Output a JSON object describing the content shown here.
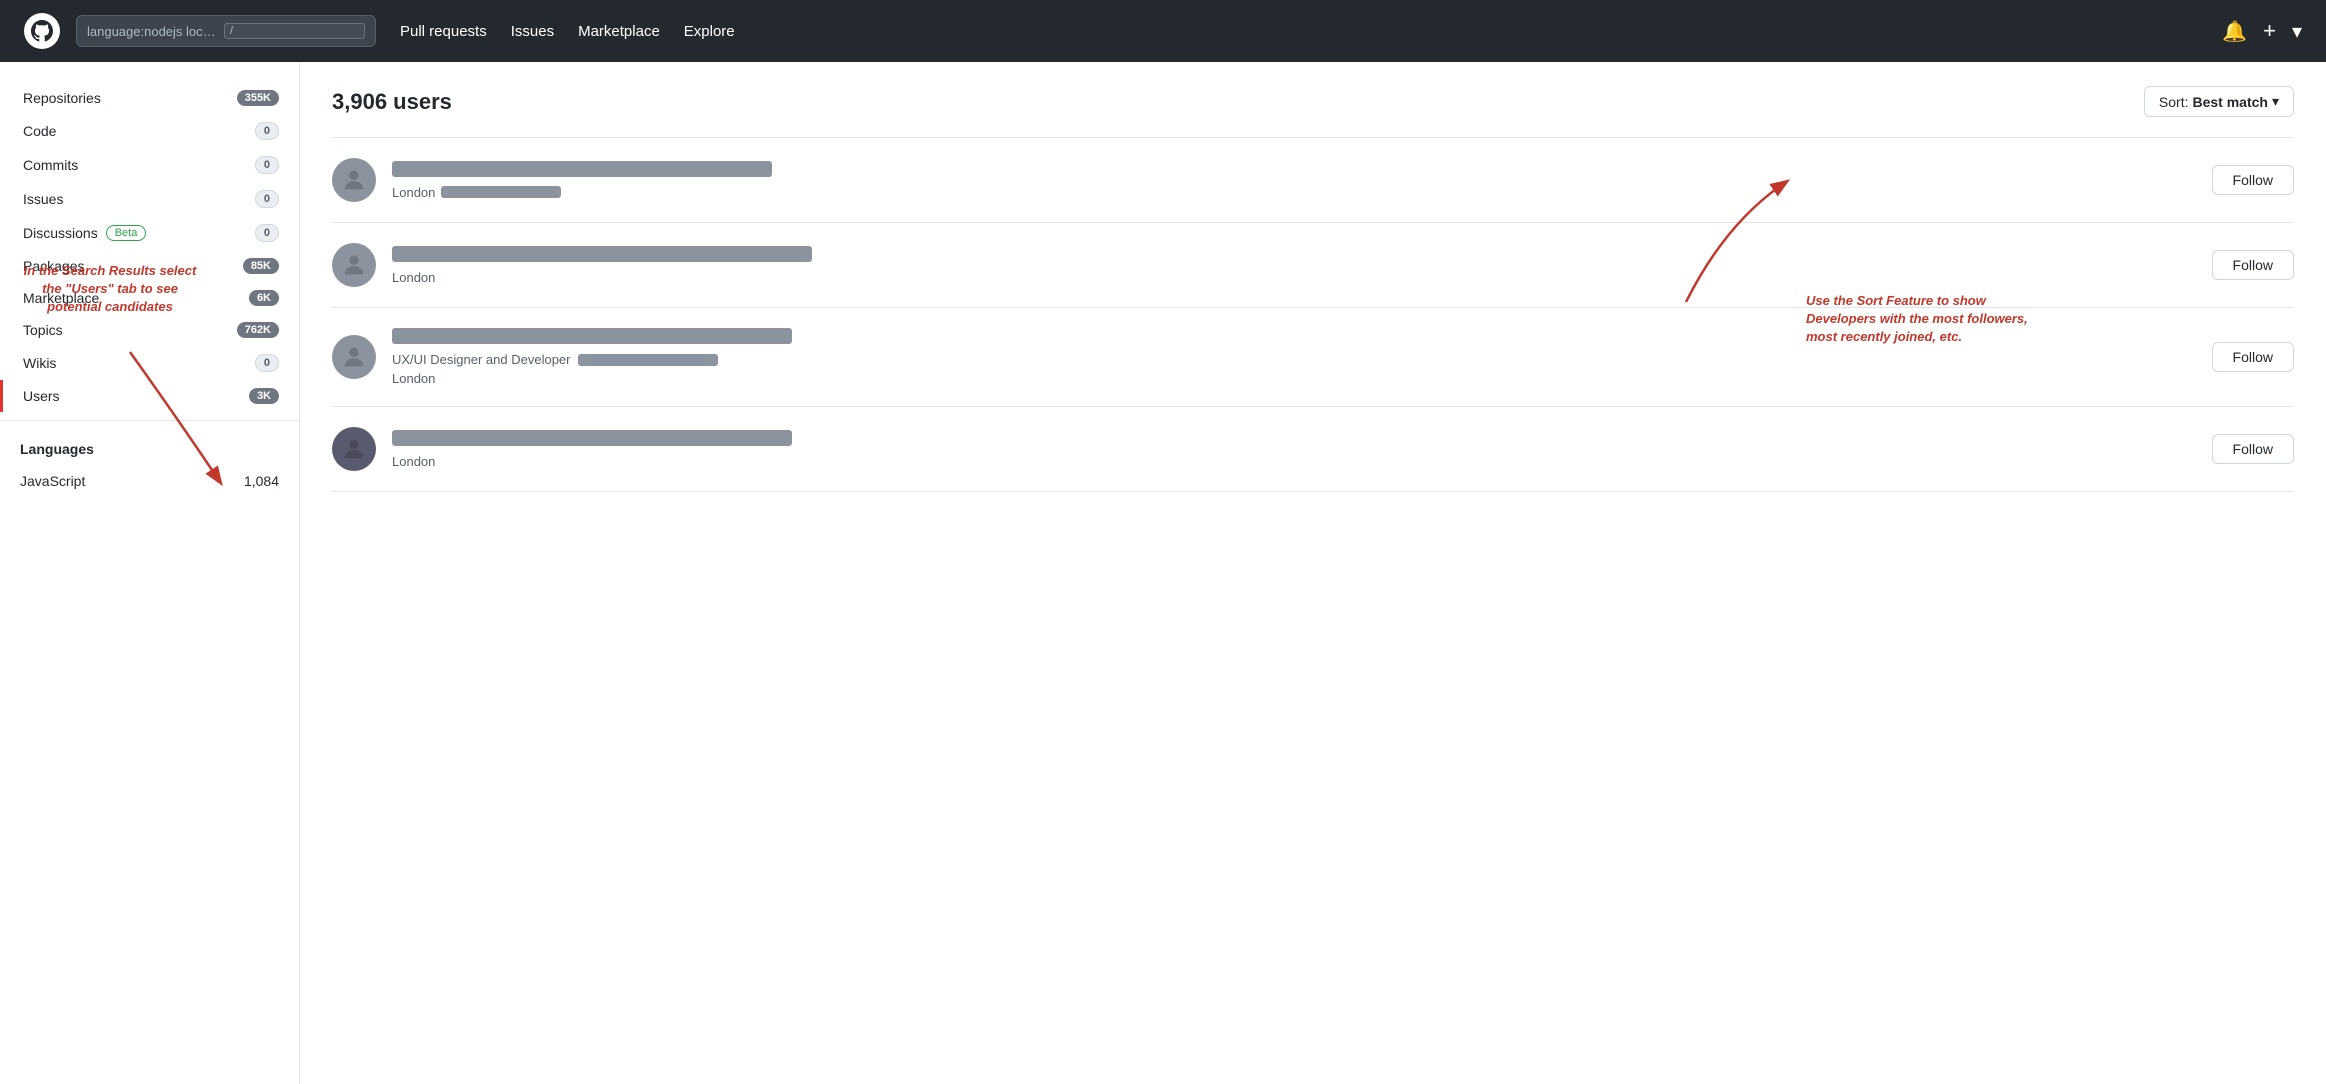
{
  "header": {
    "search_value": "language:nodejs location:london f",
    "kbd_label": "/",
    "nav_items": [
      {
        "label": "Pull requests",
        "href": "#"
      },
      {
        "label": "Issues",
        "href": "#"
      },
      {
        "label": "Marketplace",
        "href": "#"
      },
      {
        "label": "Explore",
        "href": "#"
      }
    ]
  },
  "sidebar": {
    "items": [
      {
        "label": "Repositories",
        "badge": "355K",
        "badge_type": "dark",
        "active": false
      },
      {
        "label": "Code",
        "badge": "0",
        "badge_type": "light",
        "active": false
      },
      {
        "label": "Commits",
        "badge": "0",
        "badge_type": "light",
        "active": false
      },
      {
        "label": "Issues",
        "badge": "0",
        "badge_type": "light",
        "active": false
      },
      {
        "label": "Discussions",
        "badge": "0",
        "badge_type": "light",
        "has_beta": true,
        "active": false
      },
      {
        "label": "Packages",
        "badge": "85K",
        "badge_type": "dark",
        "active": false
      },
      {
        "label": "Marketplace",
        "badge": "6K",
        "badge_type": "dark",
        "active": false
      },
      {
        "label": "Topics",
        "badge": "762K",
        "badge_type": "dark",
        "active": false
      },
      {
        "label": "Wikis",
        "badge": "0",
        "badge_type": "light",
        "active": false
      },
      {
        "label": "Users",
        "badge": "3K",
        "badge_type": "dark",
        "active": true
      }
    ],
    "languages_title": "Languages",
    "languages": [
      {
        "name": "JavaScript",
        "count": "1,084"
      }
    ]
  },
  "content": {
    "results_count": "3,906 users",
    "sort_label": "Sort:",
    "sort_value": "Best match",
    "users": [
      {
        "location": "London",
        "follow_label": "Follow"
      },
      {
        "location": "London",
        "follow_label": "Follow"
      },
      {
        "bio": "UX/UI Designer and Developer",
        "location": "London",
        "follow_label": "Follow"
      },
      {
        "location": "London",
        "follow_label": "Follow"
      }
    ]
  },
  "annotations": {
    "left_text": "In the Search Results select the \"Users\" tab to see potential candidates",
    "right_text": "Use the Sort Feature to show Developers with the most followers, most recently joined, etc."
  }
}
